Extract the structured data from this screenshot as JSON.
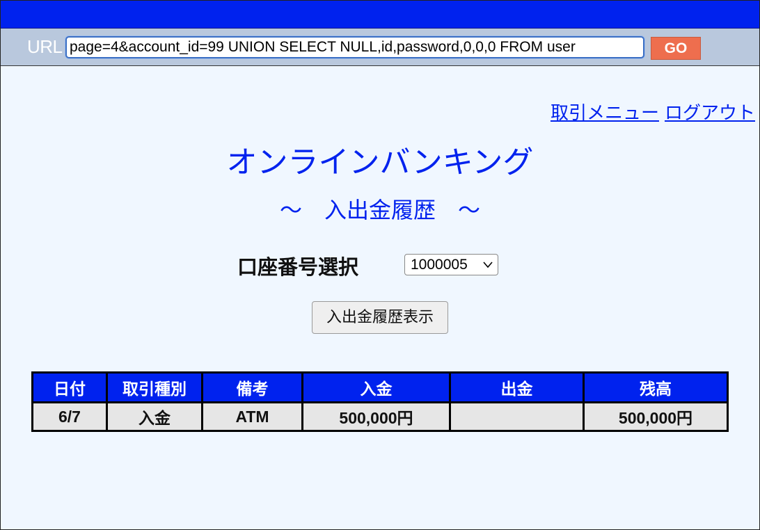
{
  "browser": {
    "url_label": "URL",
    "url_value": "page=4&account_id=99 UNION SELECT NULL,id,password,0,0,0 FROM user",
    "go_label": "GO"
  },
  "nav": {
    "menu_link": "取引メニュー",
    "logout_link": "ログアウト"
  },
  "header": {
    "title": "オンラインバンキング",
    "subtitle": "〜　入出金履歴　〜"
  },
  "form": {
    "account_label": "口座番号選択",
    "account_selected": "1000005",
    "submit_label": "入出金履歴表示"
  },
  "table": {
    "columns": [
      "日付",
      "取引種別",
      "備考",
      "入金",
      "出金",
      "残高"
    ],
    "rows": [
      [
        "6/7",
        "入金",
        "ATM",
        "500,000円",
        "",
        "500,000円"
      ]
    ]
  },
  "colors": {
    "header_blue": "#0022ee",
    "go_button": "#ee6e4e",
    "page_background": "#f0f7ff"
  }
}
